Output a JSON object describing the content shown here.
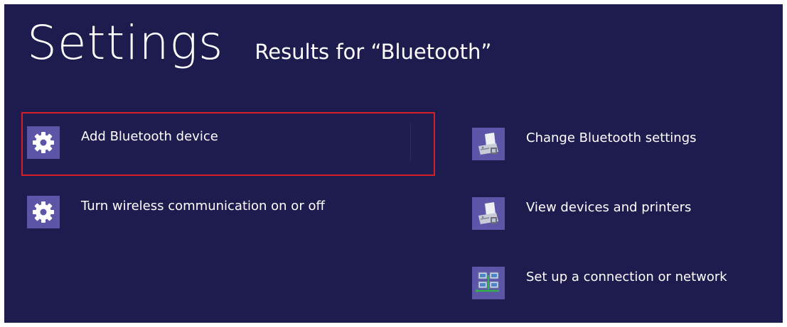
{
  "header": {
    "title": "Settings",
    "subtitle": "Results for “Bluetooth”"
  },
  "results_left": [
    {
      "label": "Add Bluetooth device",
      "icon": "gear-icon",
      "selected": true
    },
    {
      "label": "Turn wireless communication on or off",
      "icon": "gear-icon",
      "selected": false
    }
  ],
  "results_right": [
    {
      "label": "Change Bluetooth settings",
      "icon": "devices-printers-icon"
    },
    {
      "label": "View devices and printers",
      "icon": "devices-printers-icon"
    },
    {
      "label": "Set up a connection or network",
      "icon": "network-icon"
    }
  ],
  "colors": {
    "background": "#1e1b4e",
    "icon_tile": "#5d55a8",
    "selection_border": "#d21f2a"
  }
}
